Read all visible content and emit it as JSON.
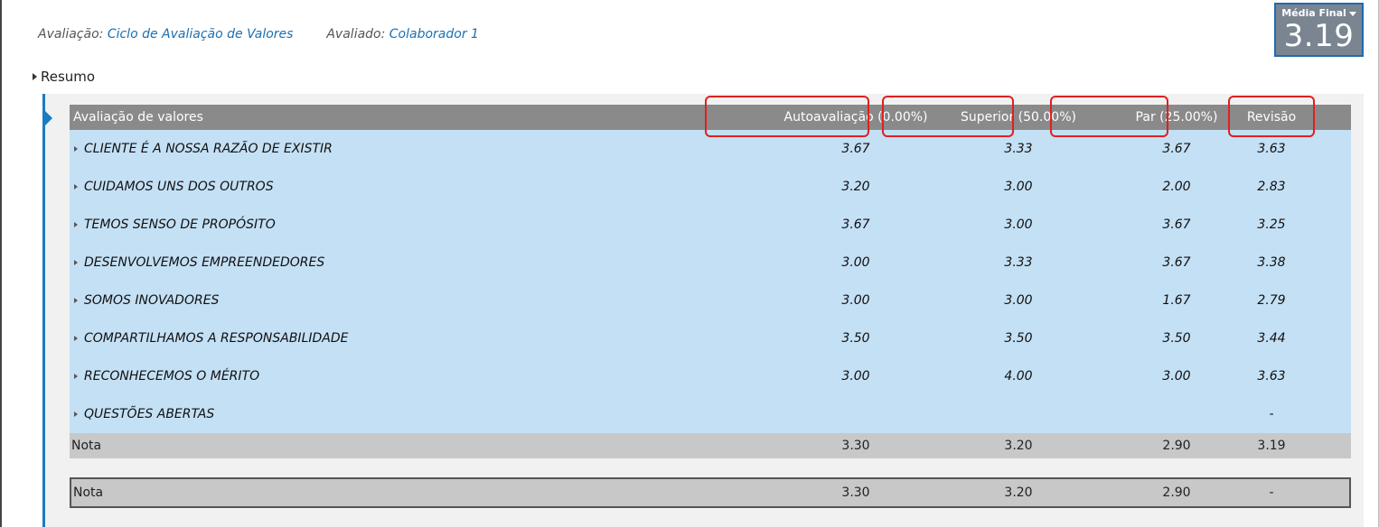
{
  "header": {
    "avaliacao_label": "Avaliação:",
    "avaliacao_value": "Ciclo de Avaliação de Valores",
    "avaliado_label": "Avaliado:",
    "avaliado_value": "Colaborador 1"
  },
  "media_final": {
    "label": "Média Final",
    "value": "3.19"
  },
  "section": {
    "title": "Resumo"
  },
  "table": {
    "columns": [
      "Avaliação de valores",
      "Autoavaliação (0.00%)",
      "Superior (50.00%)",
      "Par (25.00%)",
      "Revisão"
    ],
    "rows": [
      {
        "name": "CLIENTE É A NOSSA RAZÃO DE EXISTIR",
        "auto": "3.67",
        "superior": "3.33",
        "par": "3.67",
        "revisao": "3.63"
      },
      {
        "name": "CUIDAMOS UNS DOS OUTROS",
        "auto": "3.20",
        "superior": "3.00",
        "par": "2.00",
        "revisao": "2.83"
      },
      {
        "name": "TEMOS SENSO DE PROPÓSITO",
        "auto": "3.67",
        "superior": "3.00",
        "par": "3.67",
        "revisao": "3.25"
      },
      {
        "name": "DESENVOLVEMOS EMPREENDEDORES",
        "auto": "3.00",
        "superior": "3.33",
        "par": "3.67",
        "revisao": "3.38"
      },
      {
        "name": "SOMOS INOVADORES",
        "auto": "3.00",
        "superior": "3.00",
        "par": "1.67",
        "revisao": "2.79"
      },
      {
        "name": "COMPARTILHAMOS A RESPONSABILIDADE",
        "auto": "3.50",
        "superior": "3.50",
        "par": "3.50",
        "revisao": "3.44"
      },
      {
        "name": "RECONHECEMOS O MÉRITO",
        "auto": "3.00",
        "superior": "4.00",
        "par": "3.00",
        "revisao": "3.63"
      },
      {
        "name": "QUESTÕES ABERTAS",
        "auto": "",
        "superior": "",
        "par": "",
        "revisao": "-"
      }
    ],
    "nota": {
      "label": "Nota",
      "auto": "3.30",
      "superior": "3.20",
      "par": "2.90",
      "revisao": "3.19"
    },
    "nota_final": {
      "label": "Nota",
      "auto": "3.30",
      "superior": "3.20",
      "par": "2.90",
      "revisao": "-"
    }
  },
  "colors": {
    "link": "#1a6fb0",
    "header_bg": "#8a8a8a",
    "row_bg": "#c4e0f5",
    "highlight": "#e02020",
    "accent": "#1a7bc4"
  }
}
